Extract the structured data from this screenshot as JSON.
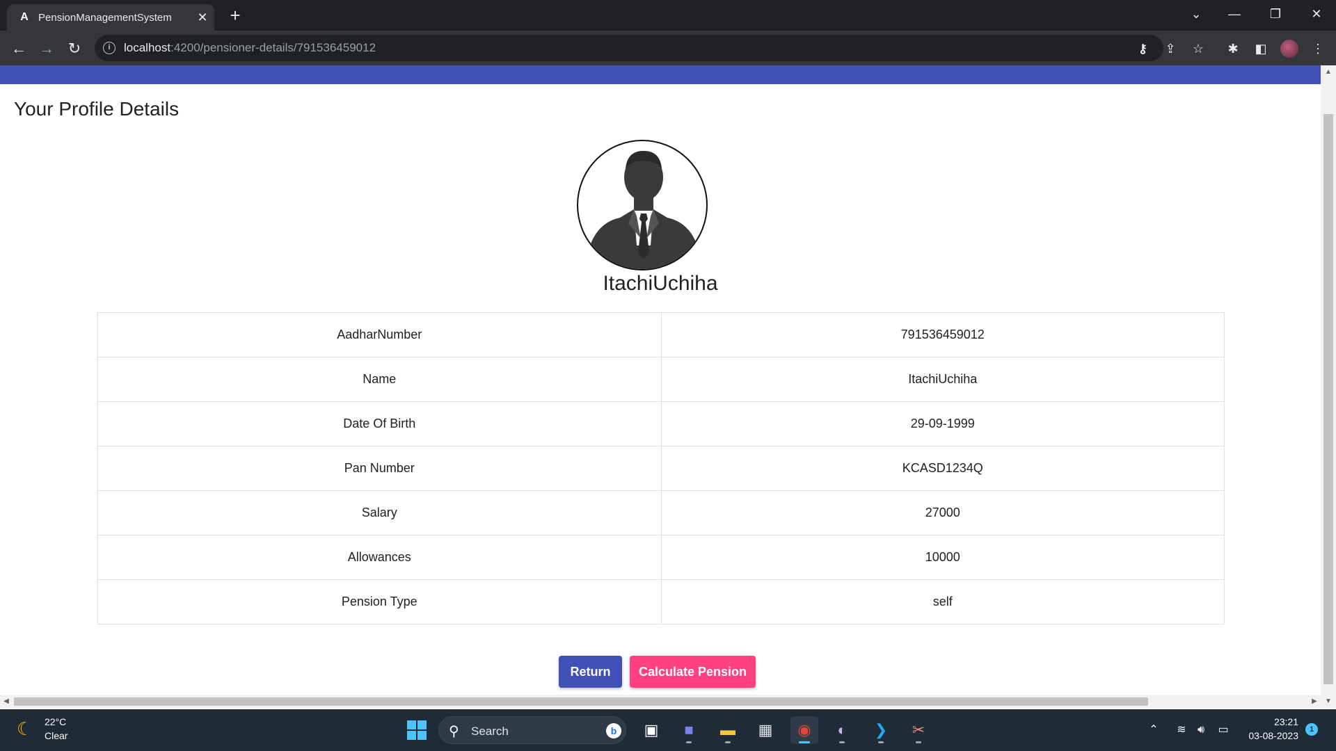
{
  "browser": {
    "tab_title": "PensionManagementSystem",
    "tab_favicon": "A",
    "url_host": "localhost",
    "url_path": ":4200/pensioner-details/791536459012"
  },
  "page": {
    "title": "Your Profile Details",
    "profile_name": "ItachiUchiha",
    "details": [
      {
        "label": "AadharNumber",
        "value": "791536459012"
      },
      {
        "label": "Name",
        "value": "ItachiUchiha"
      },
      {
        "label": "Date Of Birth",
        "value": "29-09-1999"
      },
      {
        "label": "Pan Number",
        "value": "KCASD1234Q"
      },
      {
        "label": "Salary",
        "value": "27000"
      },
      {
        "label": "Allowances",
        "value": "10000"
      },
      {
        "label": "Pension Type",
        "value": "self"
      }
    ],
    "buttons": {
      "return_label": "Return",
      "calculate_label": "Calculate Pension"
    },
    "colors": {
      "primary": "#3f51b5",
      "accent": "#ff4081"
    }
  },
  "taskbar": {
    "weather_temp": "22°C",
    "weather_desc": "Clear",
    "search_label": "Search",
    "time": "23:21",
    "date": "03-08-2023",
    "notification_count": "1"
  }
}
